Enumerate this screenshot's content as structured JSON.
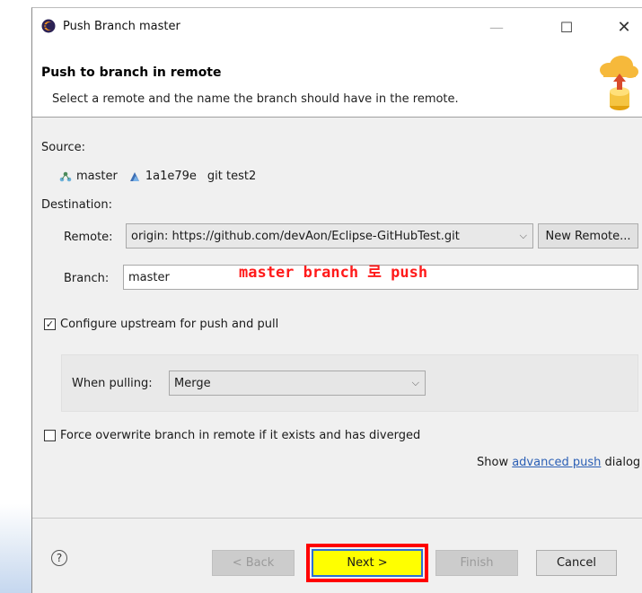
{
  "window": {
    "title": "Push Branch master",
    "min_glyph": "—",
    "max_glyph": "☐",
    "close_glyph": "✕"
  },
  "header": {
    "title": "Push to branch in remote",
    "description": "Select a remote and the name the branch should have in the remote."
  },
  "source": {
    "label": "Source:",
    "branch": "master",
    "commit_id": "1a1e79e",
    "commit_message": "git test2"
  },
  "destination": {
    "label": "Destination:",
    "remote_label": "Remote:",
    "remote_value": "origin: https://github.com/devAon/Eclipse-GitHubTest.git",
    "new_remote_label": "New Remote...",
    "branch_label": "Branch:",
    "branch_value": "master"
  },
  "annotation": "master branch 로 push",
  "upstream": {
    "label": "Configure upstream for push and pull",
    "checked": true,
    "check_glyph": "✓",
    "pull_label": "When pulling:",
    "pull_value": "Merge"
  },
  "force": {
    "label": "Force overwrite branch in remote if it exists and has diverged",
    "checked": false
  },
  "advanced": {
    "prefix": "Show ",
    "link": "advanced push",
    "suffix": " dialog"
  },
  "footer": {
    "help_glyph": "?",
    "back": "< Back",
    "next": "Next >",
    "finish": "Finish",
    "cancel": "Cancel"
  },
  "icons": {
    "app": "eclipse-icon",
    "header_art": "push-to-remote-icon",
    "branch": "branch-icon",
    "commit": "commit-icon",
    "dropdown": "chevron-down-icon",
    "help": "help-icon"
  },
  "colors": {
    "annotation": "#ff1a1a",
    "highlight_box": "#ff0000",
    "next_fill": "#ffff00",
    "link": "#2b5fb5"
  }
}
